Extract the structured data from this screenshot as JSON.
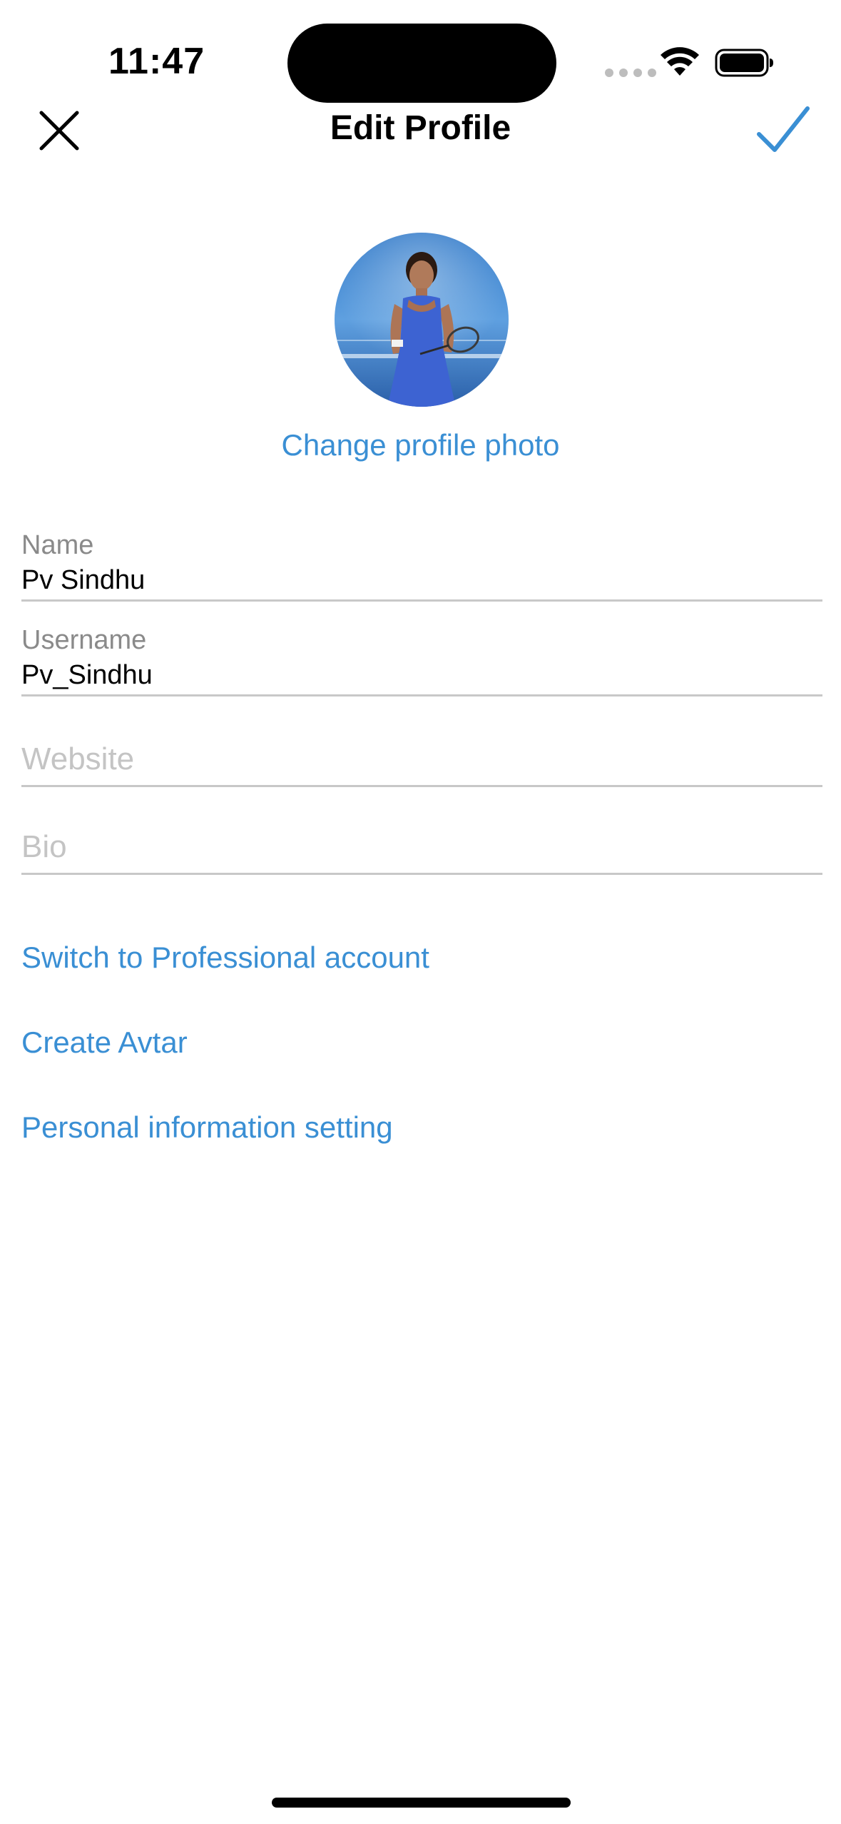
{
  "status_bar": {
    "time": "11:47"
  },
  "nav": {
    "title": "Edit Profile",
    "close_icon": "close-icon",
    "done_icon": "checkmark-icon"
  },
  "profile": {
    "change_photo_label": "Change profile photo"
  },
  "fields": {
    "name": {
      "label": "Name",
      "value": "Pv Sindhu"
    },
    "username": {
      "label": "Username",
      "value": "Pv_Sindhu"
    },
    "website": {
      "placeholder": "Website"
    },
    "bio": {
      "placeholder": "Bio"
    }
  },
  "links": {
    "professional": "Switch to Professional account",
    "avatar": "Create Avtar",
    "personal_info": "Personal information setting"
  },
  "colors": {
    "accent": "#3a8fd4",
    "label_gray": "#8a8a8a",
    "placeholder_gray": "#c4c4c4",
    "divider": "#c8c8c8"
  }
}
